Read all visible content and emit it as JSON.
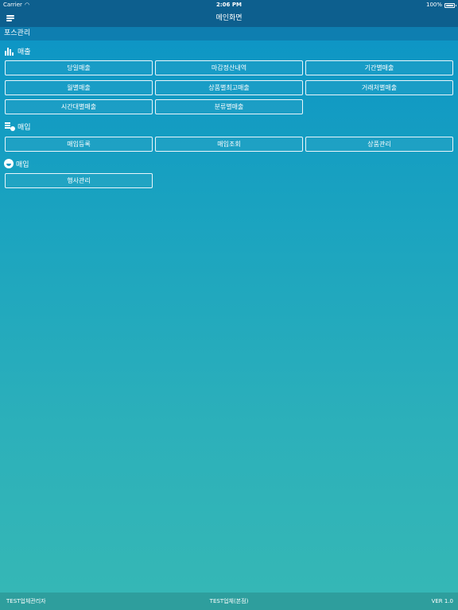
{
  "status_bar": {
    "carrier": "Carrier",
    "time": "2:06 PM",
    "battery": "100%"
  },
  "nav": {
    "title": "메인화면",
    "menu_icon": "hamburger-menu-icon"
  },
  "subheader": {
    "title": "포스관리"
  },
  "sections": {
    "sales": {
      "title": "매출",
      "icon": "bar-chart-icon",
      "buttons": [
        "당일매출",
        "마감정산내역",
        "기간별매출",
        "월별매출",
        "상품별최고매출",
        "거래처별매출",
        "시간대별매출",
        "분류별매출"
      ]
    },
    "purchase": {
      "title": "매입",
      "icon": "document-icon",
      "buttons": [
        "매입등록",
        "매입조회",
        "상품관리"
      ]
    },
    "event": {
      "title": "매입",
      "icon": "smile-icon",
      "buttons": [
        "행사관리"
      ]
    }
  },
  "footer": {
    "left": "TEST업체관리자",
    "center": "TEST업체(본점)",
    "right": "VER 1.0"
  },
  "colors": {
    "topbar": "#0d5f8e",
    "subbar": "#0e7eb0",
    "footer": "#2e9e9d",
    "gradient_top": "#0b93c6",
    "gradient_bottom": "#36b8b5"
  }
}
